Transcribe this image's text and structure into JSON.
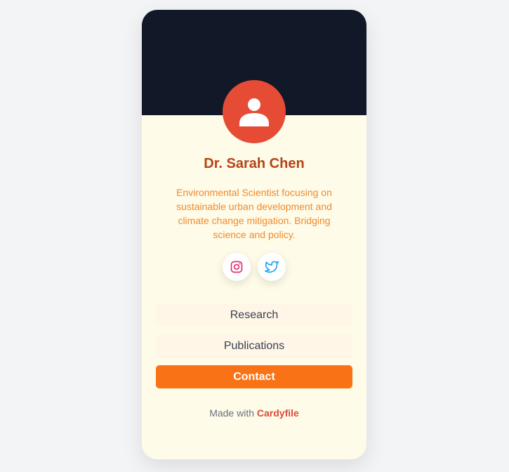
{
  "profile": {
    "name": "Dr. Sarah Chen",
    "bio": "Environmental Scientist focusing on sustainable urban development and climate change mitigation. Bridging science and policy."
  },
  "socials": [
    {
      "name": "Instagram",
      "icon": "instagram-icon",
      "color": "#e1306c"
    },
    {
      "name": "Twitter",
      "icon": "twitter-icon",
      "color": "#1da1f2"
    }
  ],
  "links": [
    {
      "label": "Research"
    },
    {
      "label": "Publications"
    },
    {
      "label": "Contact"
    }
  ],
  "footer": {
    "prefix": "Made with",
    "brand": "Cardyfile"
  },
  "colors": {
    "banner": "#111827",
    "avatar": "#e54b35",
    "card_background": "#fefbe8",
    "accent": "#f97316",
    "name": "#b74317",
    "bio": "#f08a2c"
  }
}
